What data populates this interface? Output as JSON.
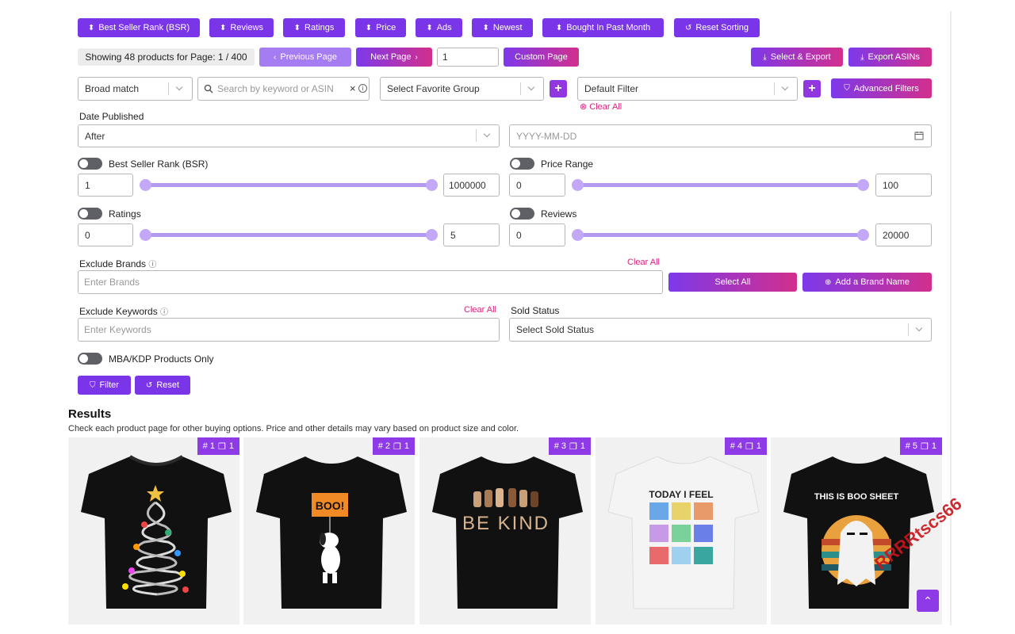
{
  "sort_buttons": [
    {
      "label": "Best Seller Rank (BSR)",
      "icon": "sort-icon"
    },
    {
      "label": "Reviews",
      "icon": "sort-icon"
    },
    {
      "label": "Ratings",
      "icon": "sort-icon"
    },
    {
      "label": "Price",
      "icon": "sort-icon"
    },
    {
      "label": "Ads",
      "icon": "sort-icon"
    },
    {
      "label": "Newest",
      "icon": "sort-icon"
    },
    {
      "label": "Bought In Past Month",
      "icon": "sort-icon"
    },
    {
      "label": "Reset Sorting",
      "icon": "reset-icon"
    }
  ],
  "pagination": {
    "showing_text": "Showing 48 products for Page: 1 / 400",
    "previous_label": "Previous Page",
    "next_label": "Next Page",
    "page_value": "1",
    "custom_page_label": "Custom Page"
  },
  "export": {
    "select_export_label": "Select & Export",
    "export_asins_label": "Export ASINs"
  },
  "search": {
    "match_type": "Broad match",
    "keyword_placeholder": "Search by keyword or ASIN",
    "favorite_group_placeholder": "Select Favorite Group",
    "filter_select": "Default Filter",
    "advanced_filters_label": "Advanced Filters",
    "clear_all_label": "Clear All"
  },
  "date_published": {
    "label": "Date Published",
    "mode": "After",
    "date_placeholder": "YYYY-MM-DD"
  },
  "ranges": {
    "bsr": {
      "label": "Best Seller Rank (BSR)",
      "min": "1",
      "max": "1000000",
      "enabled": false
    },
    "price": {
      "label": "Price Range",
      "min": "0",
      "max": "100",
      "enabled": false
    },
    "ratings": {
      "label": "Ratings",
      "min": "0",
      "max": "5",
      "enabled": false
    },
    "reviews": {
      "label": "Reviews",
      "min": "0",
      "max": "20000",
      "enabled": false
    }
  },
  "exclude_brands": {
    "label": "Exclude Brands",
    "clear_label": "Clear All",
    "placeholder": "Enter Brands",
    "select_all_label": "Select All",
    "add_brand_label": "Add a Brand Name"
  },
  "exclude_keywords": {
    "label": "Exclude Keywords",
    "clear_label": "Clear All",
    "placeholder": "Enter Keywords"
  },
  "sold_status": {
    "label": "Sold Status",
    "placeholder": "Select Sold Status"
  },
  "mba_toggle": {
    "label": "MBA/KDP Products Only",
    "enabled": false
  },
  "actions": {
    "filter_label": "Filter",
    "reset_label": "Reset"
  },
  "results": {
    "title": "Results",
    "subtitle": "Check each product page for other buying options. Price and other details may vary based on product size and color.",
    "products": [
      {
        "rank": "# 1",
        "count": "1",
        "shirt_color": "#111111",
        "design": "dna-christmas-tree"
      },
      {
        "rank": "# 2",
        "count": "1",
        "shirt_color": "#111111",
        "design": "snoopy-boo-sign",
        "design_text": "BOO!"
      },
      {
        "rank": "# 3",
        "count": "1",
        "shirt_color": "#111111",
        "design": "be-kind-sign-language",
        "design_text": "BE KIND"
      },
      {
        "rank": "# 4",
        "count": "1",
        "shirt_color": "#f4f4f4",
        "design": "today-i-feel-grid",
        "design_text": "TODAY I FEEL"
      },
      {
        "rank": "# 5",
        "count": "1",
        "shirt_color": "#111111",
        "design": "boo-sheet-ghost",
        "design_text": "THIS IS BOO SHEET"
      }
    ]
  },
  "watermark": {
    "text": "RRRRtscs66",
    "color": "#c8151b"
  },
  "colors": {
    "primary": "#7b35e8",
    "accent": "#d4277e",
    "slider": "#b298ee"
  }
}
